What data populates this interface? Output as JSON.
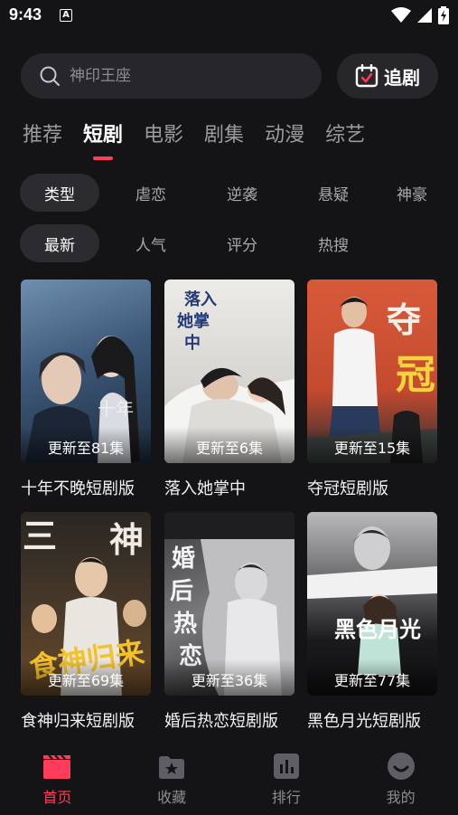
{
  "status": {
    "time": "9:43",
    "notification": "A"
  },
  "search": {
    "placeholder": "神印王座"
  },
  "follow_button": {
    "label": "追剧"
  },
  "tabs": [
    {
      "label": "推荐",
      "active": false
    },
    {
      "label": "短剧",
      "active": true
    },
    {
      "label": "电影",
      "active": false
    },
    {
      "label": "剧集",
      "active": false
    },
    {
      "label": "动漫",
      "active": false
    },
    {
      "label": "综艺",
      "active": false
    }
  ],
  "filters": {
    "genre": [
      "类型",
      "虐恋",
      "逆袭",
      "悬疑",
      "神豪"
    ],
    "sort": [
      "最新",
      "人气",
      "评分",
      "热搜"
    ]
  },
  "cards": [
    {
      "title": "十年不晚短剧版",
      "badge": "更新至81集"
    },
    {
      "title": "落入她掌中",
      "badge": "更新至6集"
    },
    {
      "title": "夺冠短剧版",
      "badge": "更新至15集"
    },
    {
      "title": "食神归来短剧版",
      "badge": "更新至69集"
    },
    {
      "title": "婚后热恋短剧版",
      "badge": "更新至36集"
    },
    {
      "title": "黑色月光短剧版",
      "badge": "更新至77集"
    }
  ],
  "nav": [
    {
      "label": "首页",
      "icon": "clapperboard-icon",
      "active": true
    },
    {
      "label": "收藏",
      "icon": "folder-star-icon",
      "active": false
    },
    {
      "label": "排行",
      "icon": "chart-icon",
      "active": false
    },
    {
      "label": "我的",
      "icon": "smile-face-icon",
      "active": false
    }
  ],
  "colors": {
    "accent": "#ff3d5a",
    "background": "#141416",
    "surface": "#27272b"
  }
}
